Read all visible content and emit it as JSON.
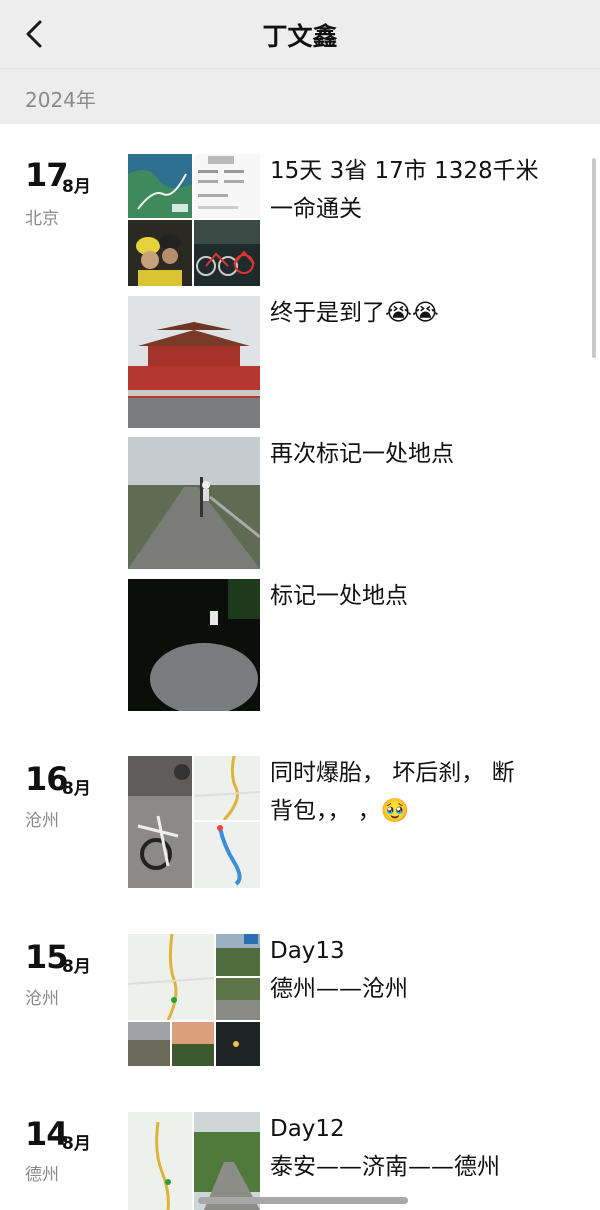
{
  "nav": {
    "title": "丁文鑫",
    "back_icon": "chevron-left-icon"
  },
  "year": "2024年",
  "groups": [
    {
      "day": "17",
      "month": "8月",
      "location": "北京"
    },
    {
      "day": "16",
      "month": "8月",
      "location": "沧州"
    },
    {
      "day": "15",
      "month": "8月",
      "location": "沧州"
    },
    {
      "day": "14",
      "month": "8月",
      "location": "德州"
    }
  ],
  "posts": [
    {
      "lines": [
        "15天 3省 17市 1328千米",
        "一命通关"
      ]
    },
    {
      "lines": [
        "终于是到了😭😭"
      ]
    },
    {
      "lines": [
        "再次标记一处地点"
      ]
    },
    {
      "lines": [
        "标记一处地点"
      ]
    },
    {
      "lines": [
        "同时爆胎， 坏后刹， 断",
        "背包，，  ，🥹"
      ]
    },
    {
      "lines": [
        "Day13",
        "德州——沧州"
      ]
    },
    {
      "lines": [
        "Day12",
        "泰安——济南——德州"
      ]
    }
  ],
  "thumbnails": [
    "map-thumbnail",
    "route-stats-thumbnail",
    "cyclists-photo-thumbnail",
    "bikes-night-photo-thumbnail",
    "tiananmen-photo-thumbnail",
    "road-cycling-photo-thumbnail",
    "night-road-photo-thumbnail",
    "bike-repair-photo-thumbnail",
    "map-thumbnail",
    "map-thumbnail",
    "map-thumbnail",
    "roadside-photo-thumbnail"
  ]
}
